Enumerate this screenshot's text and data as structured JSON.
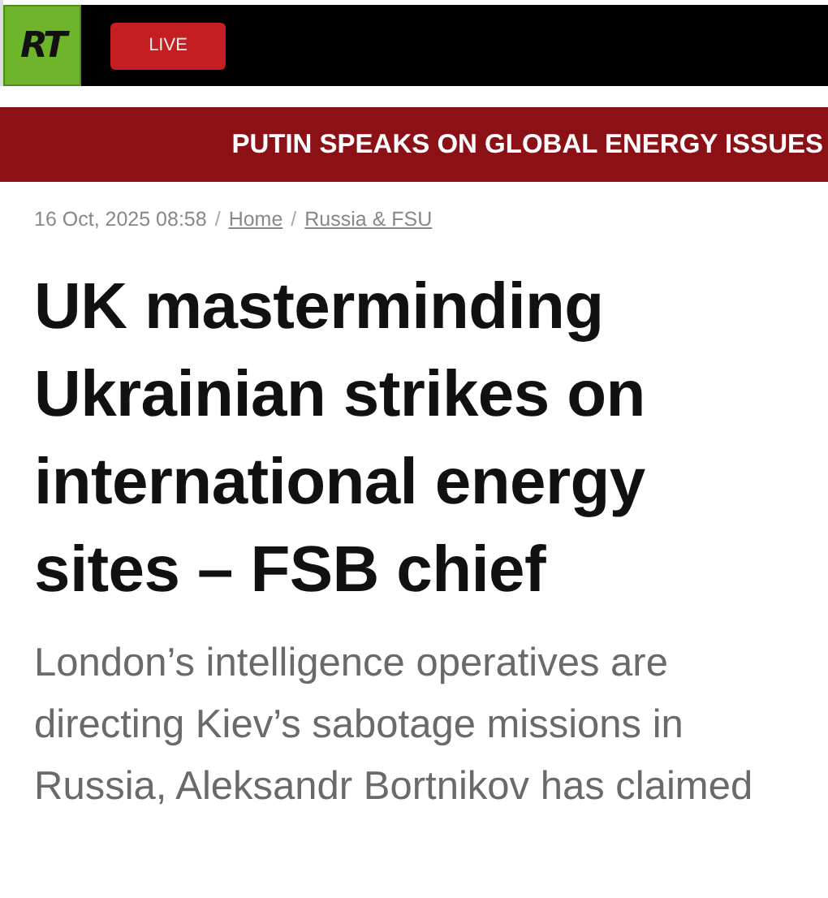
{
  "header": {
    "logo": "RT",
    "live_button": "LIVE"
  },
  "banner": "PUTIN SPEAKS ON GLOBAL ENERGY ISSUES",
  "breadcrumb": {
    "date": "16 Oct, 2025 08:58",
    "separator": "/",
    "items": [
      {
        "label": "Home"
      },
      {
        "label": "Russia & FSU"
      }
    ]
  },
  "headline": "UK masterminding Ukrainian strikes on international energy sites – FSB chief",
  "summary": "London’s intelligence operatives are directing Kiev’s sabotage missions in Russia, Aleksandr Bortnikov has claimed"
}
